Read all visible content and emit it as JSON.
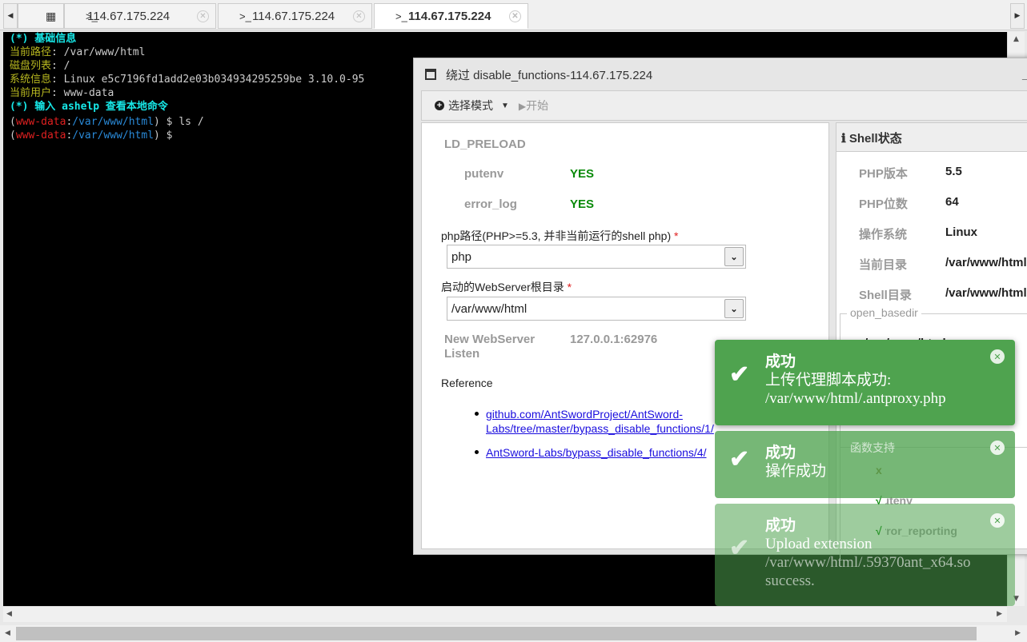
{
  "tabs": [
    {
      "label": "114.67.175.224",
      "icon": "terminal-icon"
    },
    {
      "label": "114.67.175.224",
      "icon": "terminal-icon"
    },
    {
      "label": "114.67.175.224",
      "icon": "terminal-icon",
      "active": true
    }
  ],
  "terminal": {
    "header1": "(*) 基础信息",
    "path_label": "当前路径",
    "path": "/var/www/html",
    "disk_label": "磁盘列表",
    "disk": "/",
    "sys_label": "系统信息",
    "sys": "Linux e5c7196fd1add2e03b034934295259be 3.10.0-95",
    "user_label": "当前用户",
    "user": "www-data",
    "header2": "(*) 输入 ashelp 查看本地命令",
    "prompt_user": "www-data",
    "prompt_path": "/var/www/html",
    "cmd1": "ls /"
  },
  "dialog": {
    "title": "绕过 disable_functions-114.67.175.224",
    "toolbar": {
      "mode_label": "选择模式",
      "start_label": "开始"
    },
    "left": {
      "section": "LD_PRELOAD",
      "checks": [
        {
          "name": "putenv",
          "value": "YES"
        },
        {
          "name": "error_log",
          "value": "YES"
        }
      ],
      "php_path_label": "php路径(PHP>=5.3, 并非当前运行的shell php)",
      "php_path_value": "php",
      "webroot_label": "启动的WebServer根目录",
      "webroot_value": "/var/www/html",
      "listen_label": "New WebServer Listen",
      "listen_value": "127.0.0.1:62976",
      "reference_label": "Reference",
      "links": [
        "github.com/AntSwordProject/AntSword-Labs/tree/master/bypass_disable_functions/1/",
        "AntSword-Labs/bypass_disable_functions/4/"
      ]
    },
    "right": {
      "title": "Shell状态",
      "rows": [
        {
          "k": "PHP版本",
          "v": "5.5"
        },
        {
          "k": "PHP位数",
          "v": "64"
        },
        {
          "k": "操作系统",
          "v": "Linux"
        },
        {
          "k": "当前目录",
          "v": "/var/www/html"
        },
        {
          "k": "Shell目录",
          "v": "/var/www/html"
        }
      ],
      "open_basedir_label": "open_basedir",
      "open_basedir_value": "/var/www/html",
      "funcs_label": "函数支持",
      "funcs": [
        {
          "name": "dl",
          "mark": "x"
        },
        {
          "name": "putenv",
          "mark": "√"
        },
        {
          "name": "error_reporting",
          "mark": "√"
        }
      ]
    }
  },
  "toasts": [
    {
      "title": "成功",
      "lines": [
        "上传代理脚本成功:",
        "/var/www/html/.antproxy.php"
      ]
    },
    {
      "title": "成功",
      "lines": [
        "操作成功"
      ]
    },
    {
      "title": "成功",
      "lines": [
        "Upload extension",
        "/var/www/html/.59370ant_x64.so",
        "success."
      ]
    }
  ],
  "colors": {
    "success": "#4fa34f",
    "yes": "#0a8a0a",
    "link": "#1a0dde"
  }
}
